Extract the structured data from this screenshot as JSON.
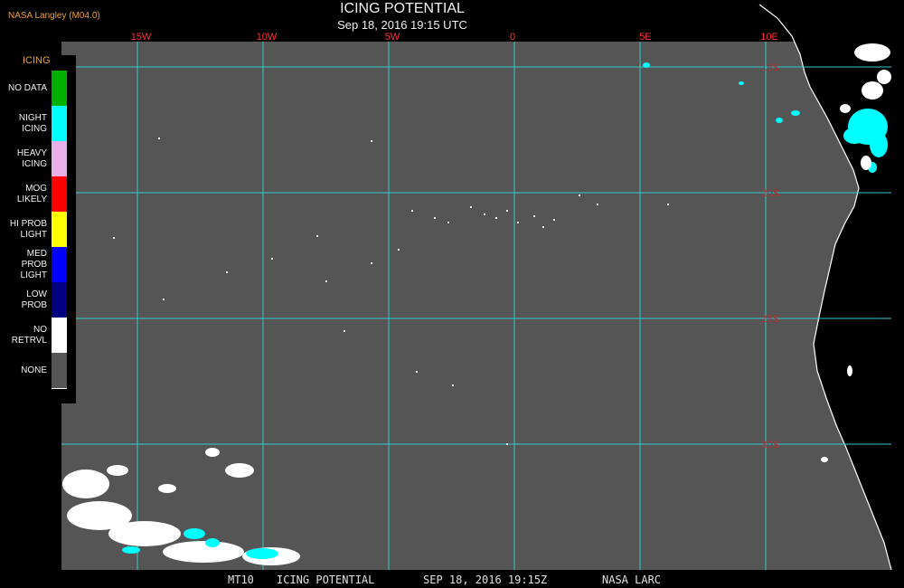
{
  "header": {
    "source": "NASA Langley (M04.0)",
    "title": "ICING POTENTIAL",
    "datetime": "Sep 18, 2016 19:15 UTC"
  },
  "colors": {
    "background": "#000000",
    "ocean": "#555555",
    "grid": "#33cccc",
    "coast": "#ffffff",
    "lon_label": "#ff3333",
    "lat_label": "#b83030",
    "accent": "#e8a13a"
  },
  "map": {
    "longitude_labels": [
      "15W",
      "10W",
      "5W",
      "0",
      "5E",
      "10E"
    ],
    "latitude_labels": [
      "15S",
      "20S",
      "25S",
      "30S"
    ]
  },
  "legend": {
    "title": "ICING",
    "items": [
      {
        "label": "NO DATA",
        "color": "#00b000"
      },
      {
        "label": "NIGHT\nICING",
        "color": "#00ffff"
      },
      {
        "label": "HEAVY\nICING",
        "color": "#e8b0e8"
      },
      {
        "label": "MOG\nLIKELY",
        "color": "#ff0000"
      },
      {
        "label": "HI PROB\nLIGHT",
        "color": "#ffff00"
      },
      {
        "label": "MED PROB\nLIGHT",
        "color": "#0000ff"
      },
      {
        "label": "LOW\nPROB",
        "color": "#000080"
      },
      {
        "label": "NO\nRETRVL",
        "color": "#ffffff"
      },
      {
        "label": "NONE",
        "color": "#555555"
      }
    ]
  },
  "footer": {
    "product": "MT10",
    "title": "ICING POTENTIAL",
    "datetime": "SEP 18, 2016 19:15Z",
    "agency": "NASA LARC"
  }
}
